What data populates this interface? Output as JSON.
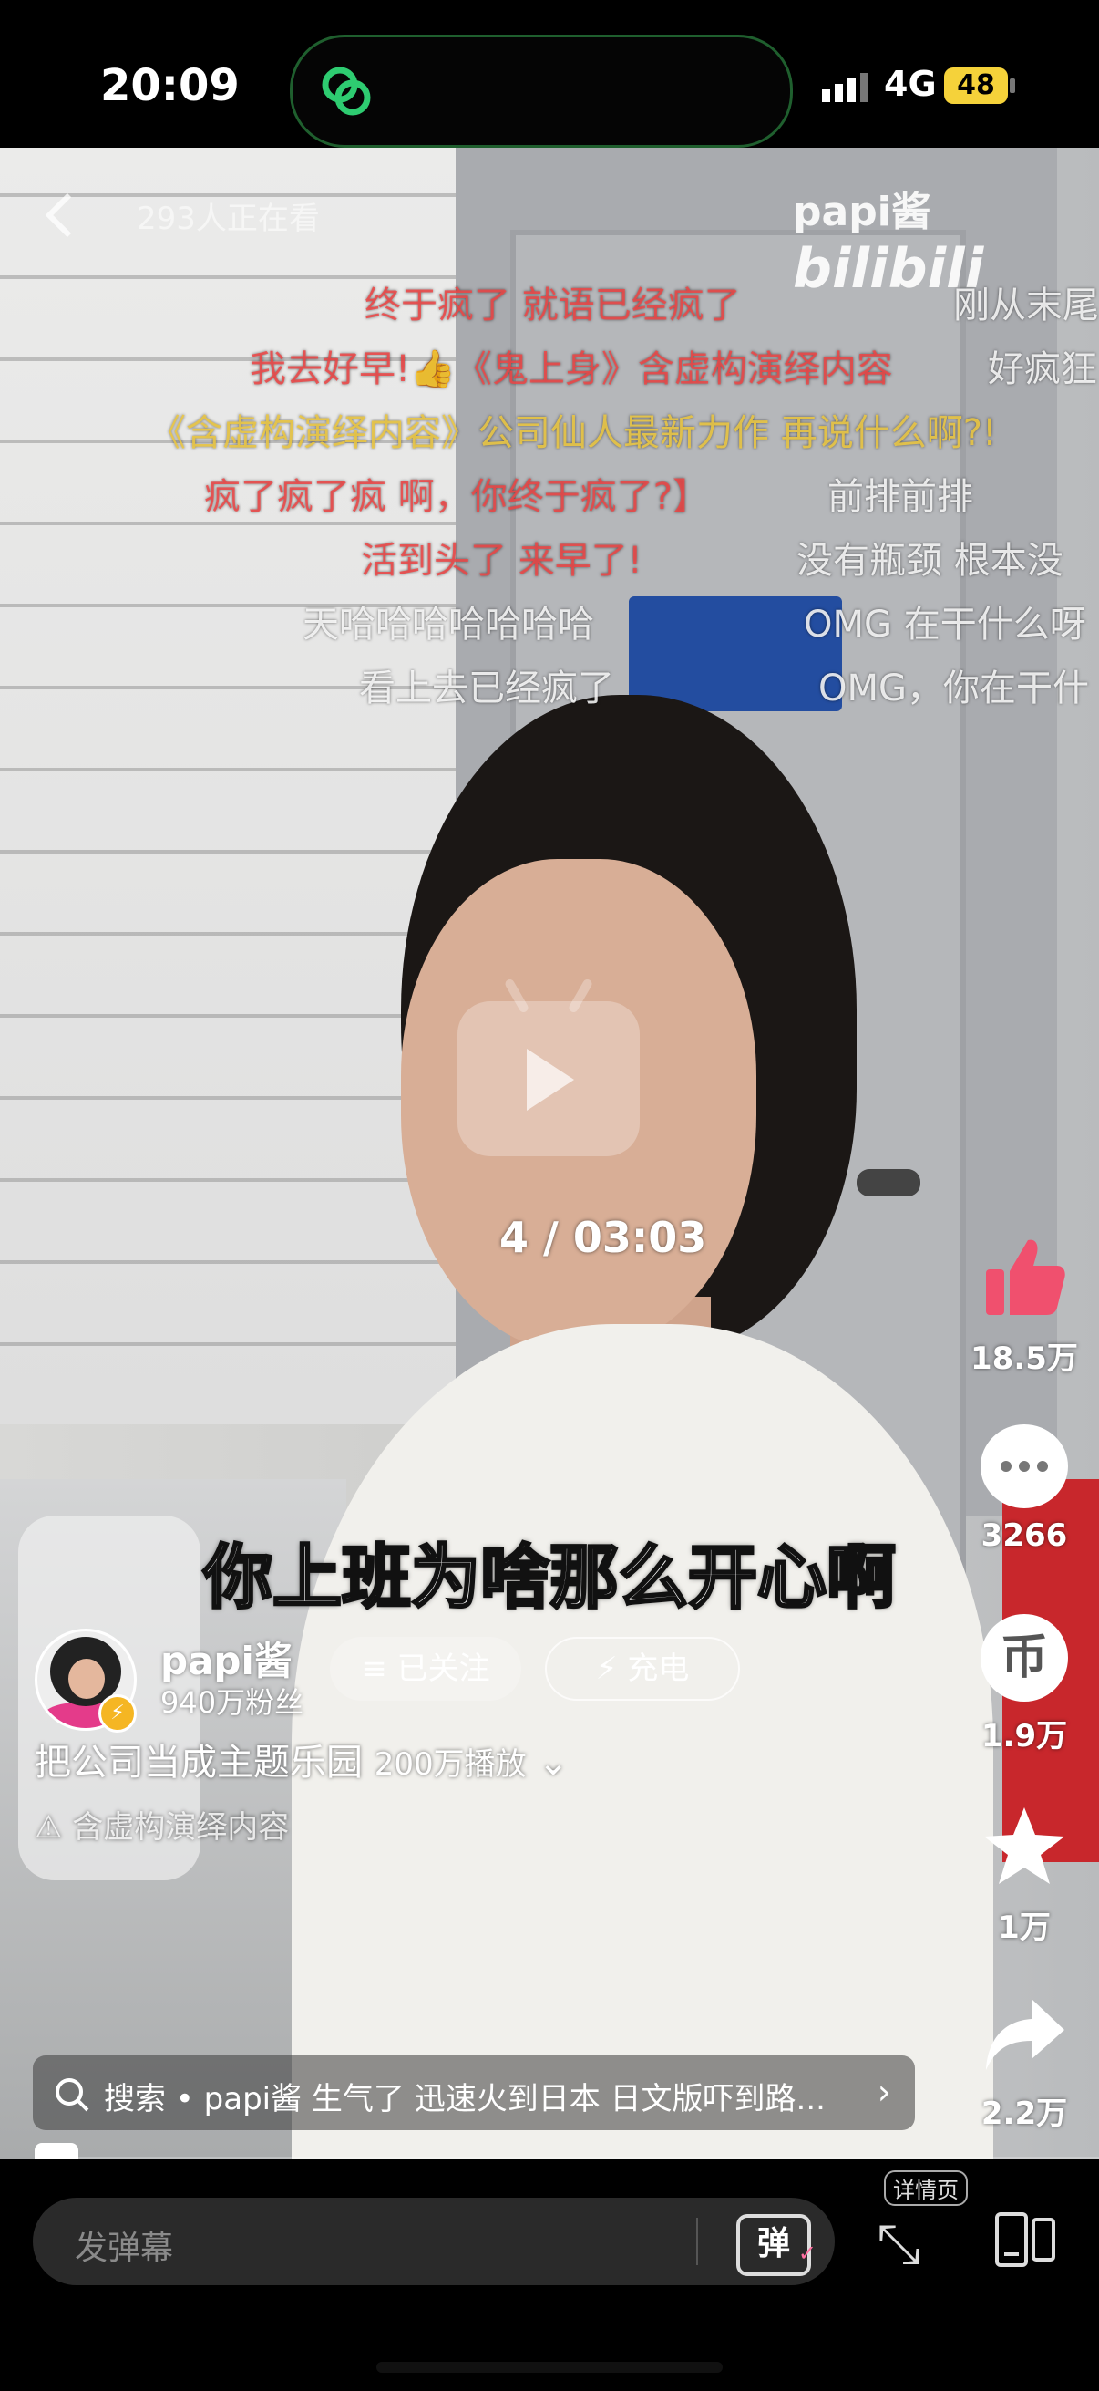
{
  "status_bar": {
    "time": "20:09",
    "network": "4G",
    "battery": "48"
  },
  "video": {
    "watching": "293人正在看",
    "watermark_user": "papi酱",
    "watermark_brand": "bilibili",
    "timestamp": "4 / 03:03",
    "subtitle": "你上班为啥那么开心啊"
  },
  "danmaku": [
    {
      "text": "终于疯了 就语已经疯了",
      "style": "red"
    },
    {
      "text": "刚从末尾",
      "style": "white"
    },
    {
      "text": "我去好早!👍《鬼上身》含虚构演绎内容",
      "style": "red"
    },
    {
      "text": "好疯狂",
      "style": "white"
    },
    {
      "text": "《含虚构演绎内容》公司仙人最新力作 再说什么啊?!",
      "style": "gold"
    },
    {
      "text": "疯了疯了疯 啊，你终于疯了?】",
      "style": "red"
    },
    {
      "text": "前排前排",
      "style": "white"
    },
    {
      "text": "活到头了 来早了!",
      "style": "red"
    },
    {
      "text": "没有瓶颈 根本没",
      "style": "white"
    },
    {
      "text": "天哈哈哈哈哈哈哈",
      "style": "white"
    },
    {
      "text": "OMG 在干什么呀",
      "style": "white"
    },
    {
      "text": "看上去已经疯了",
      "style": "white"
    },
    {
      "text": "OMG，你在干什",
      "style": "white"
    }
  ],
  "actions": {
    "like": "18.5万",
    "comment": "3266",
    "coin": "1.9万",
    "favorite": "1万",
    "share": "2.2万",
    "coin_glyph": "币"
  },
  "uploader": {
    "name": "papi酱",
    "fans": "940万粉丝",
    "follow_label": "≡ 已关注",
    "charge_label": "⚡ 充电"
  },
  "video_info": {
    "title": "把公司当成主题乐园",
    "plays": "200万播放",
    "disclaimer": "含虚构演绎内容"
  },
  "search": {
    "text": "搜索 • papi酱 生气了 迅速火到日本 日文版吓到路..."
  },
  "bottom_bar": {
    "danmaku_placeholder": "发弹幕",
    "danmaku_toggle": "弹",
    "detail_label": "详情页"
  },
  "colors": {
    "like": "#f0506e",
    "accent_green": "#2ecc71",
    "battery": "#f5d23a"
  }
}
